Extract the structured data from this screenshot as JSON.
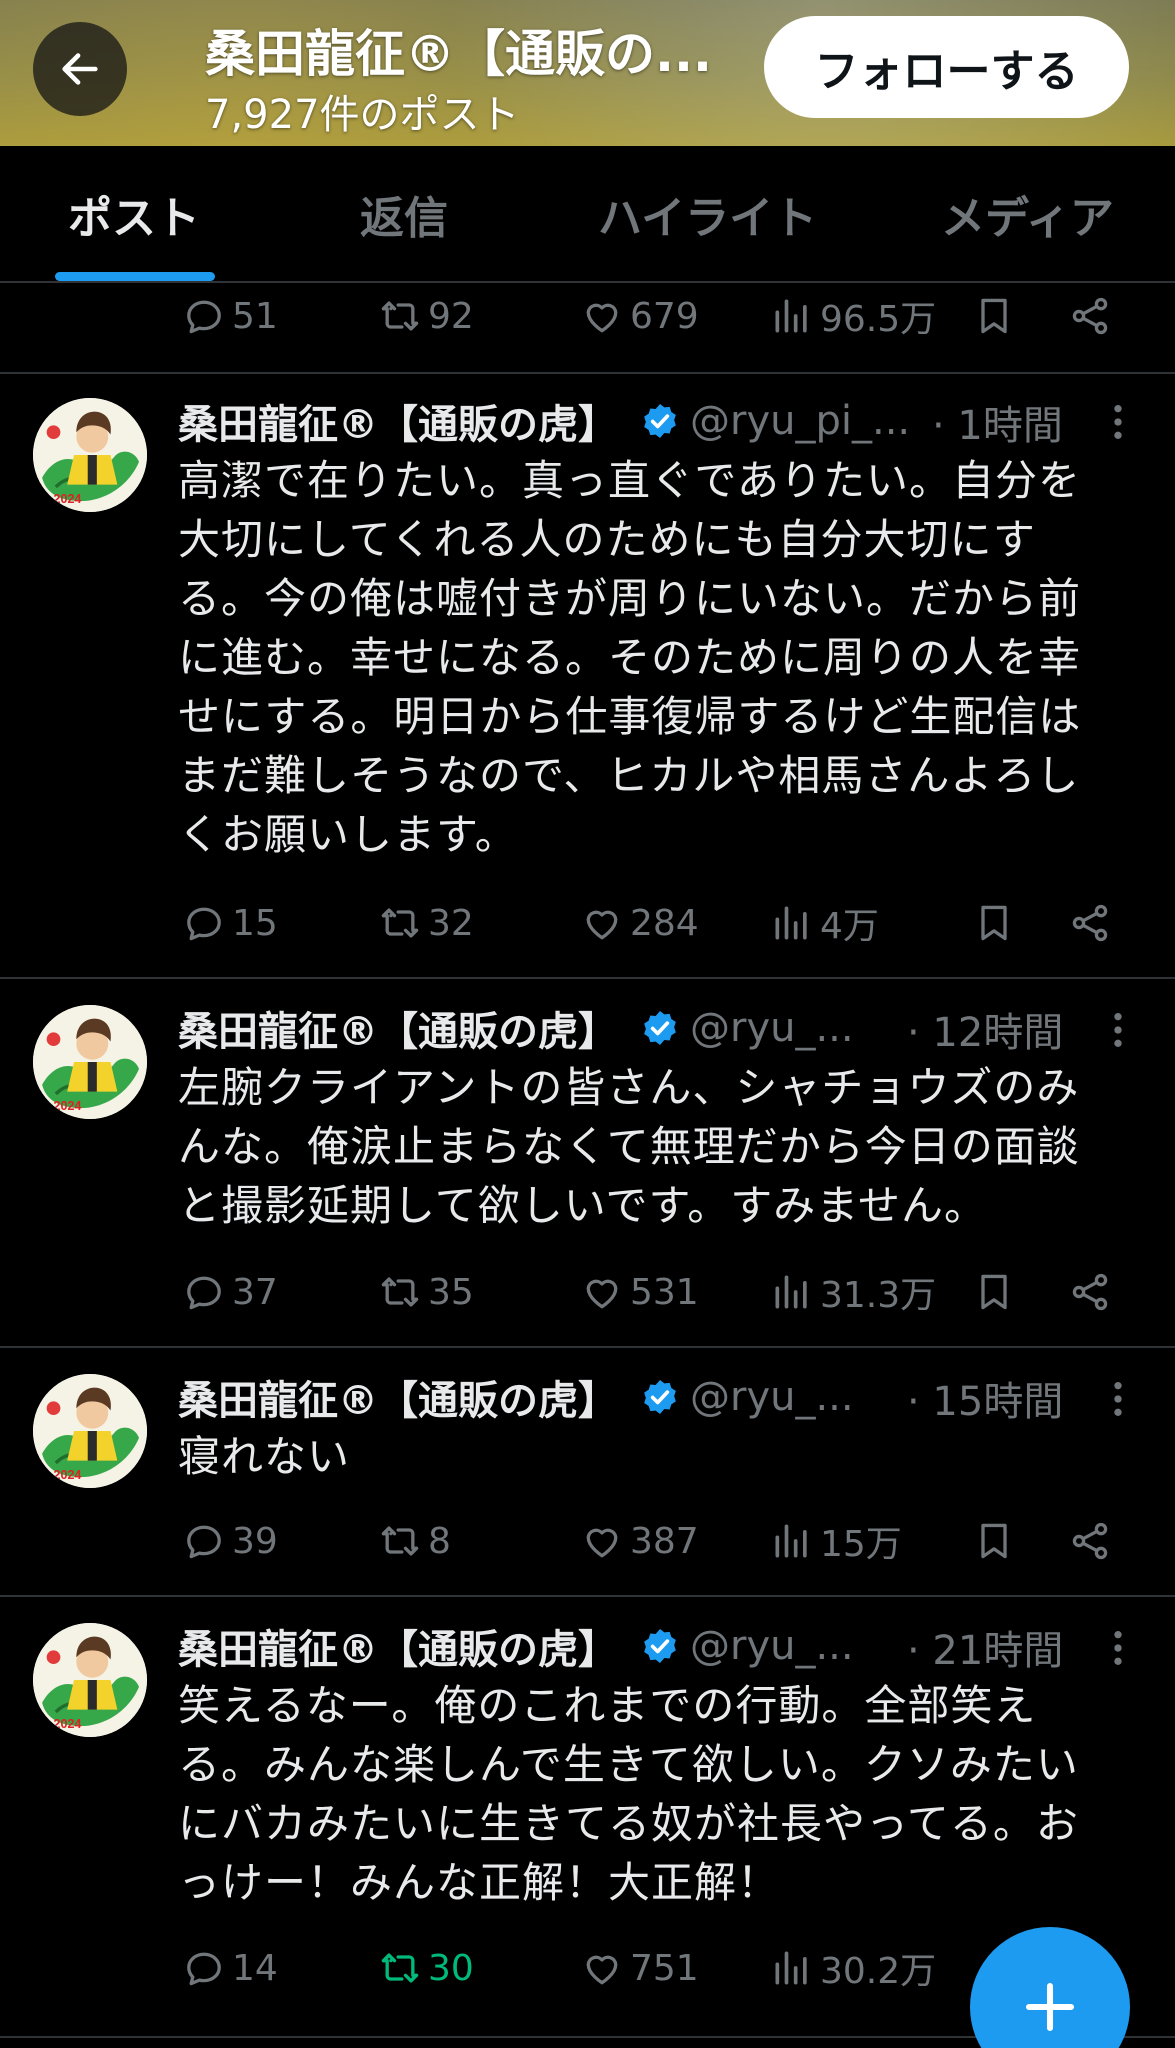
{
  "header": {
    "title": "桑田龍征®【通販の...",
    "post_count": "7,927件のポスト",
    "follow_label": "フォローする"
  },
  "tabs": [
    "ポスト",
    "返信",
    "ハイライト",
    "メディア"
  ],
  "active_tab": "ポスト",
  "top_actions": {
    "replies": "51",
    "reposts": "92",
    "likes": "679",
    "views": "96.5万"
  },
  "tweets": [
    {
      "name": "桑田龍征®【通販の虎】",
      "handle": "@ryu_pi_...",
      "time": "· 1時間",
      "lines": [
        "高潔で在りたい。真っ直ぐでありたい。自分を",
        "大切にしてくれる人のためにも自分大切にす",
        "る。今の俺は嘘付きが周りにいない。だから前",
        "に進む。幸せになる。そのために周りの人を幸",
        "せにする。明日から仕事復帰するけど生配信は",
        "まだ難しそうなので、ヒカルや相馬さんよろし",
        "くお願いします。"
      ],
      "replies": "15",
      "reposts": "32",
      "likes": "284",
      "views": "4万"
    },
    {
      "name": "桑田龍征®【通販の虎】",
      "handle": "@ryu_...",
      "time": "· 12時間",
      "lines": [
        "左腕クライアントの皆さん、シャチョウズのみ",
        "んな。俺涙止まらなくて無理だから今日の面談",
        "と撮影延期して欲しいです。すみません。"
      ],
      "replies": "37",
      "reposts": "35",
      "likes": "531",
      "views": "31.3万"
    },
    {
      "name": "桑田龍征®【通販の虎】",
      "handle": "@ryu_...",
      "time": "· 15時間",
      "lines": [
        "寝れない"
      ],
      "replies": "39",
      "reposts": "8",
      "likes": "387",
      "views": "15万"
    },
    {
      "name": "桑田龍征®【通販の虎】",
      "handle": "@ryu_...",
      "time": "· 21時間",
      "lines": [
        "笑えるなー。俺のこれまでの行動。全部笑え",
        "る。みんな楽しんで生きて欲しい。クソみたい",
        "にバカみたいに生きてる奴が社長やってる。お",
        "っけー！みんな正解！大正解！"
      ],
      "replies": "14",
      "reposts": "30",
      "likes": "751",
      "views": "30.2万",
      "reposted_by_me": true
    }
  ],
  "icons": {
    "back": "arrow-left-icon",
    "reply": "speech-bubble-icon",
    "repost": "repost-arrows-icon",
    "like": "heart-icon",
    "views": "bar-chart-icon",
    "bookmark": "bookmark-icon",
    "share": "share-icon",
    "verified": "verified-badge-icon",
    "more": "more-vertical-icon",
    "compose": "plus-icon"
  },
  "colors": {
    "accent": "#1d9bf0",
    "repost_active": "#00ba7c",
    "muted": "#71767b",
    "text": "#e7e9ea",
    "background": "#000000"
  }
}
